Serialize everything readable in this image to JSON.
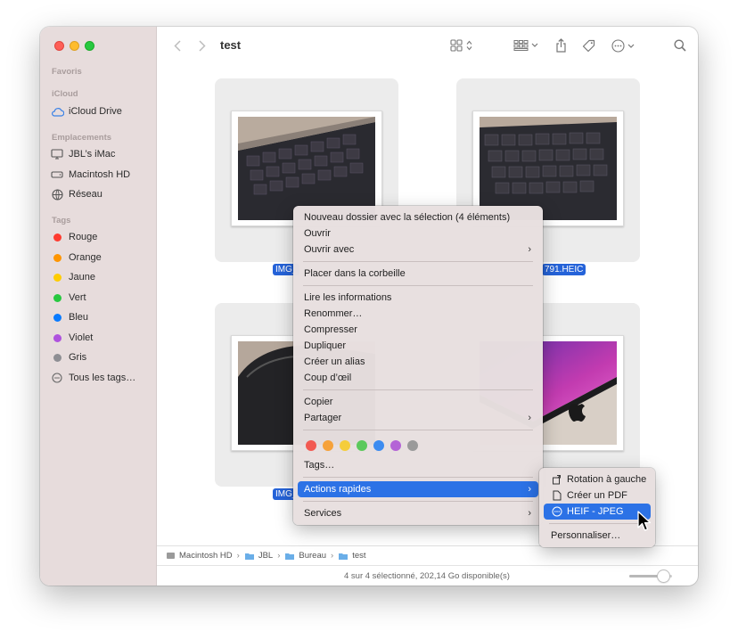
{
  "window": {
    "title": "test"
  },
  "sidebar": {
    "sections": [
      {
        "title": "Favoris",
        "items": []
      },
      {
        "title": "iCloud",
        "items": [
          {
            "label": "iCloud Drive",
            "icon": "cloud-icon"
          }
        ]
      },
      {
        "title": "Emplacements",
        "items": [
          {
            "label": "JBL’s iMac",
            "icon": "imac-icon"
          },
          {
            "label": "Macintosh HD",
            "icon": "disk-icon"
          },
          {
            "label": "Réseau",
            "icon": "network-icon"
          }
        ]
      },
      {
        "title": "Tags",
        "items": [
          {
            "label": "Rouge",
            "color": "#fe3b30"
          },
          {
            "label": "Orange",
            "color": "#fe9500"
          },
          {
            "label": "Jaune",
            "color": "#fecc00"
          },
          {
            "label": "Vert",
            "color": "#28c840"
          },
          {
            "label": "Bleu",
            "color": "#0a7bff"
          },
          {
            "label": "Violet",
            "color": "#af52de"
          },
          {
            "label": "Gris",
            "color": "#8e8e93"
          },
          {
            "label": "Tous les tags…",
            "icon": "all-tags-icon"
          }
        ]
      }
    ]
  },
  "files": [
    {
      "name": "IMG_",
      "selected": true
    },
    {
      "name": "791.HEIC",
      "selected": true
    },
    {
      "name": "IMG_",
      "selected": true
    },
    {
      "name": "",
      "selected": true
    }
  ],
  "context_menu": {
    "items": [
      "Nouveau dossier avec la sélection (4 éléments)",
      "Ouvrir",
      "Ouvrir avec",
      "Placer dans la corbeille",
      "Lire les informations",
      "Renommer…",
      "Compresser",
      "Dupliquer",
      "Créer un alias",
      "Coup d’œil",
      "Copier",
      "Partager",
      "Tags…",
      "Actions rapides",
      "Services"
    ],
    "tag_colors": [
      "#f25a52",
      "#f6a23a",
      "#f5cd3b",
      "#5cc95c",
      "#3d8cf0",
      "#b464d6",
      "#9a9a9a"
    ]
  },
  "submenu": {
    "items": [
      {
        "label": "Rotation à gauche",
        "icon": "rotate-left-icon"
      },
      {
        "label": "Créer un PDF",
        "icon": "document-icon"
      },
      {
        "label": "HEIF - JPEG",
        "icon": "ellipsis-circle-icon"
      },
      {
        "label": "Personnaliser…"
      }
    ]
  },
  "pathbar": {
    "segments": [
      "Macintosh HD",
      "JBL",
      "Bureau",
      "test"
    ]
  },
  "status": {
    "text": "4 sur 4 sélectionné, 202,14 Go disponible(s)",
    "zoom_level": 0.8
  },
  "colors": {
    "accent": "#2c72e6",
    "selection": "#2563d9",
    "sidebar": "#e7dcdc"
  }
}
